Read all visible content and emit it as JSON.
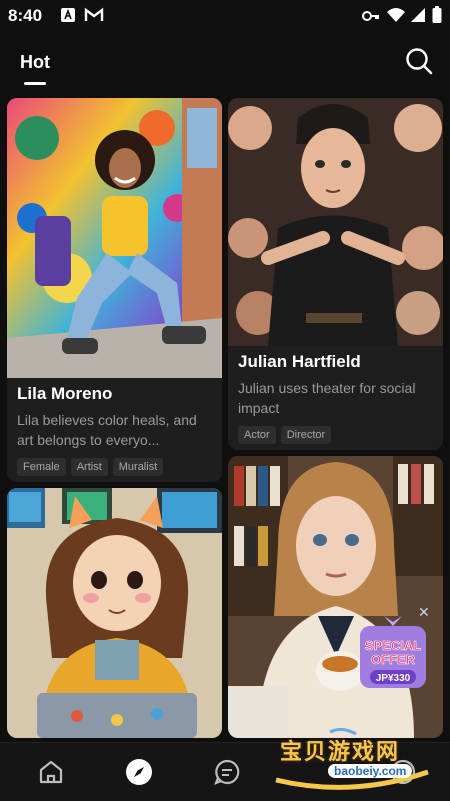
{
  "status_bar": {
    "time": "8:40"
  },
  "header": {
    "active_tab": "Hot"
  },
  "cards": [
    {
      "name": "Lila Moreno",
      "description": "Lila believes color heals, and art belongs to everyo...",
      "tags": [
        "Female",
        "Artist",
        "Muralist"
      ]
    },
    {
      "name": "Julian Hartfield",
      "description": "Julian uses theater for social impact",
      "tags": [
        "Actor",
        "Director"
      ]
    },
    {
      "name": "",
      "description": "",
      "tags": []
    },
    {
      "name": "",
      "description": "",
      "tags": []
    }
  ],
  "offer_badge": {
    "line1": "SPECIAL",
    "line2": "OFFER",
    "price": "JP¥330"
  },
  "bottom_nav": {
    "items": [
      "home-icon",
      "compass-icon",
      "chat-icon",
      "profile-icon"
    ],
    "active": "compass-icon"
  },
  "watermark": {
    "text": "宝贝游戏网",
    "url": "baobeiy.com"
  }
}
